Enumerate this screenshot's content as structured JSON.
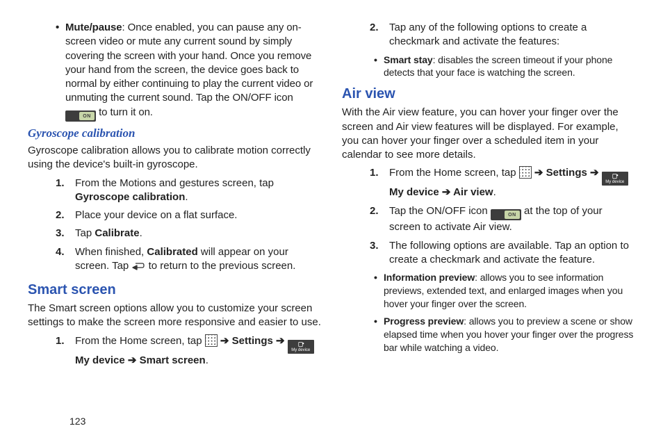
{
  "page_number": "123",
  "onoff_label": "ON",
  "mydevice_label": "My device",
  "left": {
    "mute_pause": {
      "term": "Mute/pause",
      "text_before_icon": ": Once enabled, you can pause any on-screen video or mute any current sound by simply covering the screen with your hand. Once you remove your hand from the screen, the device goes back to normal by either continuing to play the current video or unmuting the current sound. Tap the ON/OFF icon ",
      "text_after_icon": " to turn it on."
    },
    "gyro": {
      "heading": "Gyroscope calibration",
      "intro": "Gyroscope calibration allows you to calibrate motion correctly using the device's built-in gyroscope.",
      "step1_a": "From the Motions and gestures screen, tap ",
      "step1_b": "Gyroscope calibration",
      "step1_c": ".",
      "step2": "Place your device on a flat surface.",
      "step3_a": "Tap ",
      "step3_b": "Calibrate",
      "step3_c": ".",
      "step4_a": "When finished, ",
      "step4_b": "Calibrated",
      "step4_c": " will appear on your screen. Tap ",
      "step4_d": " to return to the previous screen."
    },
    "smart": {
      "heading": "Smart screen",
      "intro": "The Smart screen options allow you to customize your screen settings to make the screen more responsive and easier to use.",
      "step1_a": "From the Home screen, tap ",
      "step1_arrow": " ➔ ",
      "step1_b": "Settings",
      "step1_c": "My device",
      "step1_d": "Smart screen",
      "step1_end": "."
    }
  },
  "right": {
    "step2": "Tap any of the following options to create a checkmark and activate the features:",
    "smart_stay": {
      "term": "Smart stay",
      "text": ": disables the screen timeout if your phone detects that your face is watching the screen."
    },
    "air": {
      "heading": "Air view",
      "intro": "With the Air view feature, you can hover your finger over the screen and Air view features will be displayed. For example, you can hover your finger over a scheduled item in your calendar to see more details.",
      "step1_a": "From the Home screen, tap ",
      "step1_arrow": " ➔ ",
      "step1_b": "Settings",
      "step1_c": "My device",
      "step1_d": "Air view",
      "step1_end": ".",
      "step2_a": "Tap the ON/OFF icon ",
      "step2_b": " at the top of your screen to activate Air view.",
      "step3": "The following options are available. Tap an option to create a checkmark and activate the feature.",
      "bullet_info": {
        "term": "Information preview",
        "text": ": allows you to see information previews, extended text, and enlarged images when you hover your finger over the screen."
      },
      "bullet_progress": {
        "term": "Progress preview",
        "text": ": allows you to preview a scene or show elapsed time when you hover your finger over the progress bar while watching a video."
      }
    }
  }
}
